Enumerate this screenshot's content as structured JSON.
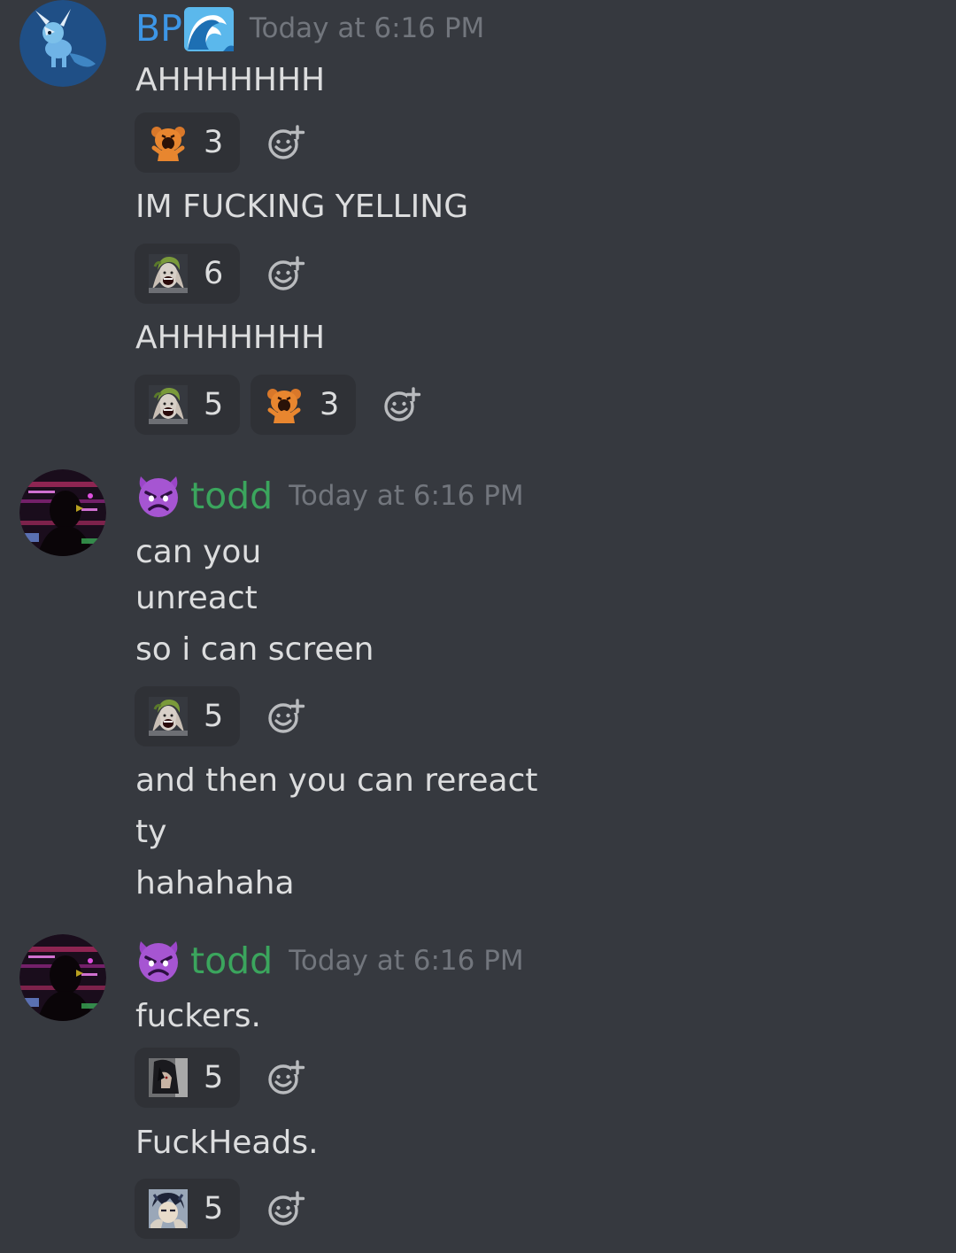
{
  "colors": {
    "background": "#36393f",
    "reaction_bg": "#2f3136",
    "text": "#dcddde",
    "timestamp": "#72767d",
    "bp_username": "#3d96e6",
    "todd_username": "#3ba55d"
  },
  "groups": [
    {
      "author": "BP",
      "author_badge_icon": "water-wave-emoji",
      "timestamp": "Today at 6:16 PM",
      "messages": [
        {
          "text": "AHHHHHHH",
          "reactions": [
            {
              "emoji": "screaming-bear-emoji",
              "count": "3"
            }
          ]
        },
        {
          "text": "IM FUCKING YELLING",
          "reactions": [
            {
              "emoji": "joker-laughing-emoji",
              "count": "6"
            }
          ]
        },
        {
          "text": "AHHHHHHH",
          "reactions": [
            {
              "emoji": "joker-laughing-emoji",
              "count": "5"
            },
            {
              "emoji": "screaming-bear-emoji",
              "count": "3"
            }
          ]
        }
      ]
    },
    {
      "author": "todd",
      "author_badge_icon": "angry-devil-emoji",
      "timestamp": "Today at 6:16 PM",
      "messages": [
        {
          "text": "can you"
        },
        {
          "text": "unreact"
        },
        {
          "text": "so i can screen",
          "reactions": [
            {
              "emoji": "joker-laughing-emoji",
              "count": "5"
            }
          ]
        },
        {
          "text": "and then you can rereact"
        },
        {
          "text": "ty"
        },
        {
          "text": "hahahaha"
        }
      ]
    },
    {
      "author": "todd",
      "author_badge_icon": "angry-devil-emoji",
      "timestamp": "Today at 6:16 PM",
      "messages": [
        {
          "text": "fuckers.",
          "reactions": [
            {
              "emoji": "anime-character-emoji",
              "count": "5"
            }
          ]
        },
        {
          "text": "FuckHeads.",
          "reactions": [
            {
              "emoji": "anime-character-2-emoji",
              "count": "5"
            }
          ]
        }
      ]
    }
  ],
  "icons": {
    "add_reaction": "add-reaction-icon"
  }
}
